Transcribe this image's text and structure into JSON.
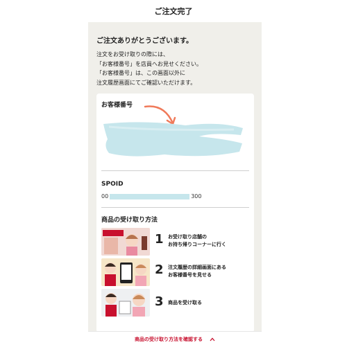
{
  "header": {
    "title": "ご注文完了"
  },
  "thanks": "ご注文ありがとうございます。",
  "notes": [
    "注文をお受け取りの際には、",
    "「お客様番号」を店員へお見せください。",
    "「お客様番号」は、この画面以外に",
    "注文履歴画面にてご確認いただけます。"
  ],
  "customer_number": {
    "label": "お客様番号"
  },
  "spoid": {
    "label": "SPOID",
    "prefix": "00",
    "suffix": "300"
  },
  "pickup": {
    "title": "商品の受け取り方法",
    "steps": [
      {
        "num": "1",
        "text": "お受け取り店舗の\nお持ち帰りコーナーに行く"
      },
      {
        "num": "2",
        "text": "注文履歴の詳細画面にある\nお客様番号を見せる"
      },
      {
        "num": "3",
        "text": "商品を受け取る"
      }
    ]
  },
  "footer": {
    "link": "商品の受け取り方法を確認する"
  },
  "colors": {
    "accent": "#c8102e",
    "panel": "#f0efea",
    "redaction": "#c6e6ec",
    "arrow": "#f07a5a"
  }
}
